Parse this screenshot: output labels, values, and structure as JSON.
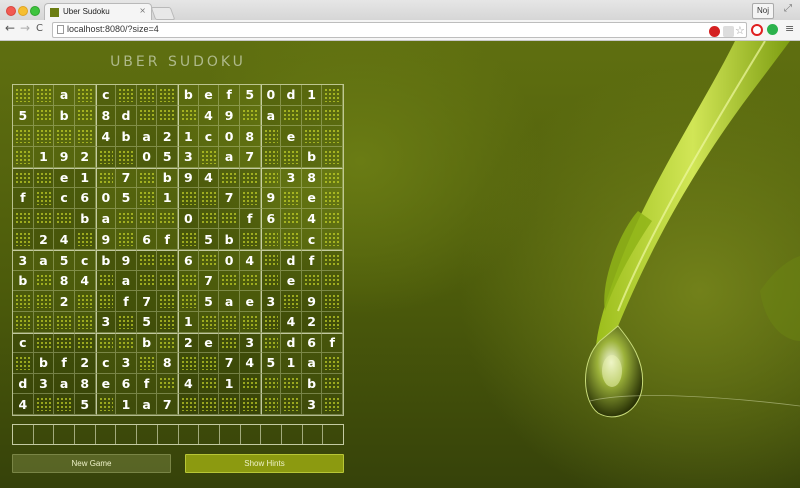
{
  "browser": {
    "tab_title": "Uber Sudoku",
    "tab_close": "×",
    "url": "localhost:8080/?size=4",
    "profile_label": "Noj",
    "nav_back": "←",
    "nav_forward": "→",
    "nav_reload": "C",
    "menu": "≡",
    "star": "☆",
    "fullscreen": "⤢"
  },
  "colors": {
    "background": "#4c5b0b",
    "hint_dot": "#c8d62a",
    "button_hints": "#8c9a10"
  },
  "app": {
    "title": "UBER SUDOKU",
    "new_game_label": "New Game",
    "show_hints_label": "Show Hints",
    "grid_size": 16,
    "grid": [
      [
        "",
        "",
        "a",
        "",
        "c",
        "",
        "",
        "",
        "b",
        "e",
        "f",
        "5",
        "0",
        "d",
        "1"
      ],
      [
        "5",
        "",
        "b",
        "",
        "8",
        "d",
        "",
        "",
        "",
        "4",
        "9",
        "",
        "a",
        "",
        ""
      ],
      [
        "",
        "",
        "",
        "",
        "4",
        "b",
        "a",
        "2",
        "1",
        "c",
        "0",
        "8",
        "",
        "e",
        ""
      ],
      [
        "",
        "1",
        "9",
        "2",
        "",
        "",
        "0",
        "5",
        "3",
        "",
        "a",
        "7",
        "",
        "",
        "b"
      ],
      [
        "",
        "",
        "e",
        "1",
        "",
        "7",
        "",
        "b",
        "9",
        "4",
        "",
        "",
        "",
        "3",
        "8"
      ],
      [
        "f",
        "",
        "c",
        "6",
        "0",
        "5",
        "",
        "1",
        "",
        "",
        "7",
        "",
        "9",
        "",
        "e"
      ],
      [
        "",
        "",
        "",
        "b",
        "a",
        "",
        "",
        "",
        "0",
        "",
        "",
        "f",
        "6",
        "",
        "4"
      ],
      [
        "",
        "2",
        "4",
        "",
        "9",
        "",
        "6",
        "f",
        "",
        "5",
        "b",
        "",
        "",
        "",
        "c"
      ],
      [
        "3",
        "a",
        "5",
        "c",
        "b",
        "9",
        "",
        "",
        "6",
        "",
        "0",
        "4",
        "",
        "d",
        "f"
      ],
      [
        "b",
        "",
        "8",
        "4",
        "",
        "a",
        "",
        "",
        "",
        "7",
        "",
        "",
        "",
        "e",
        ""
      ],
      [
        "",
        "",
        "2",
        "",
        "",
        "f",
        "7",
        "",
        "",
        "5",
        "a",
        "e",
        "3",
        "",
        "9"
      ],
      [
        "",
        "",
        "",
        "",
        "3",
        "",
        "5",
        "",
        "1",
        "",
        "",
        "",
        "",
        "4",
        "2"
      ],
      [
        "c",
        "",
        "",
        "",
        "",
        "",
        "b",
        "",
        "2",
        "e",
        "",
        "3",
        "",
        "d",
        "6",
        "f"
      ],
      [
        "",
        "b",
        "f",
        "2",
        "c",
        "3",
        "",
        "8",
        "",
        "",
        "7",
        "4",
        "5",
        "1",
        "a"
      ],
      [
        "d",
        "3",
        "a",
        "8",
        "e",
        "6",
        "f",
        "",
        "4",
        "",
        "1",
        "",
        "",
        "",
        "b",
        ""
      ],
      [
        "4",
        "",
        "",
        "5",
        "",
        "1",
        "a",
        "7",
        "",
        "",
        "",
        "",
        "",
        "",
        "3",
        ""
      ]
    ],
    "input_slots": 16
  }
}
